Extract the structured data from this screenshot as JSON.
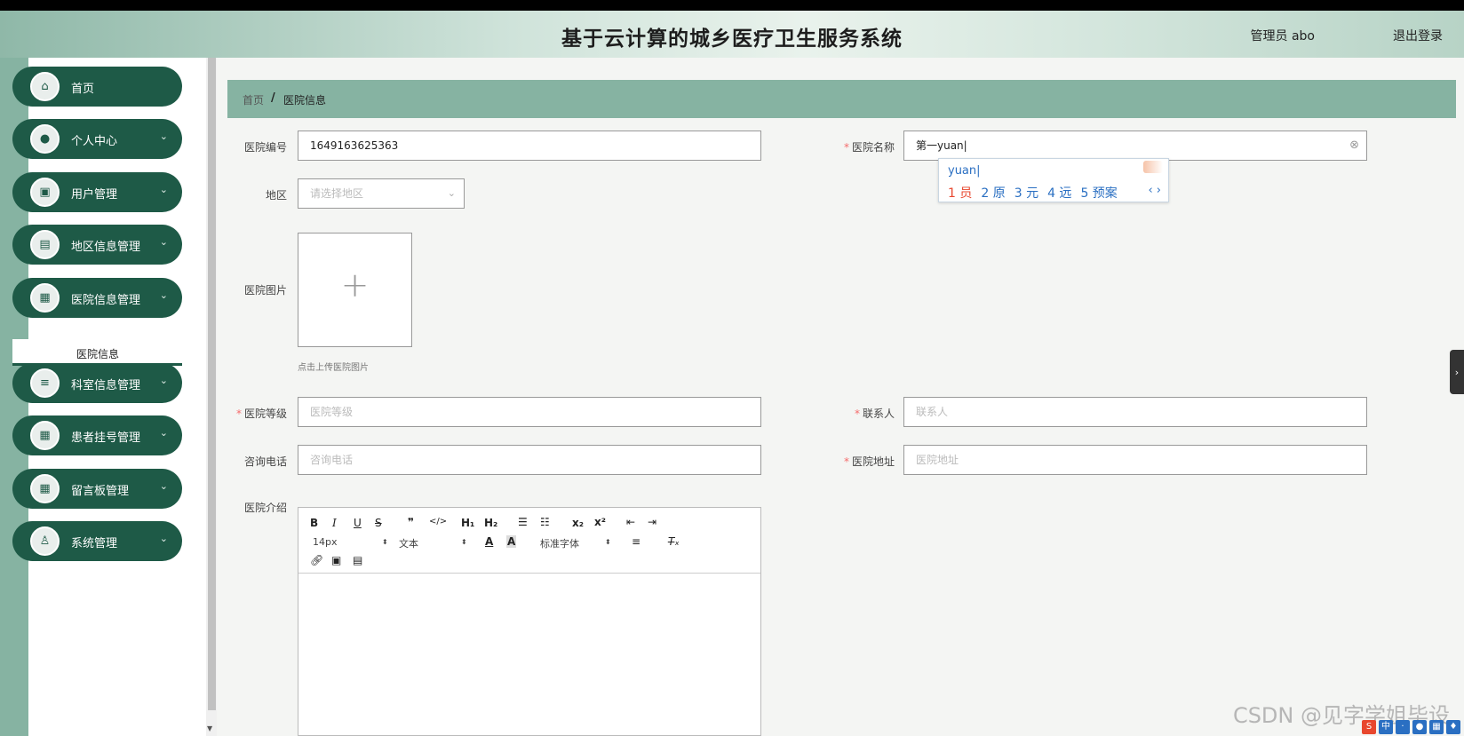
{
  "header": {
    "title": "基于云计算的城乡医疗卫生服务系统",
    "user": "管理员 abo",
    "logout": "退出登录"
  },
  "sidebar": {
    "items": [
      {
        "label": "首页",
        "icon": "home-icon",
        "glyph": "⌂",
        "chevron": ""
      },
      {
        "label": "个人中心",
        "icon": "user-icon",
        "glyph": "●",
        "chevron": "⌄"
      },
      {
        "label": "用户管理",
        "icon": "briefcase-icon",
        "glyph": "▣",
        "chevron": "⌄"
      },
      {
        "label": "地区信息管理",
        "icon": "clipboard-icon",
        "glyph": "▤",
        "chevron": "⌄"
      },
      {
        "label": "医院信息管理",
        "icon": "grid-icon",
        "glyph": "▦",
        "chevron": "⌄"
      },
      {
        "label": "科室信息管理",
        "icon": "list-icon",
        "glyph": "≡",
        "chevron": "⌄"
      },
      {
        "label": "患者挂号管理",
        "icon": "grid-icon",
        "glyph": "▦",
        "chevron": "⌄"
      },
      {
        "label": "留言板管理",
        "icon": "grid-icon",
        "glyph": "▦",
        "chevron": "⌄"
      },
      {
        "label": "系统管理",
        "icon": "person-icon",
        "glyph": "♙",
        "chevron": "⌄"
      }
    ],
    "submenu_active": "医院信息"
  },
  "breadcrumb": {
    "home": "首页",
    "separator": "/",
    "current": "医院信息"
  },
  "form": {
    "hospital_no": {
      "label": "医院编号",
      "value": "1649163625363"
    },
    "hospital_name": {
      "label": "医院名称",
      "value": "第一yuan",
      "required": "*"
    },
    "region": {
      "label": "地区",
      "placeholder": "请选择地区"
    },
    "image": {
      "label": "医院图片",
      "tip": "点击上传医院图片",
      "plus": "+"
    },
    "level": {
      "label": "医院等级",
      "placeholder": "医院等级",
      "required": "*"
    },
    "contact": {
      "label": "联系人",
      "placeholder": "联系人",
      "required": "*"
    },
    "phone": {
      "label": "咨询电话",
      "placeholder": "咨询电话"
    },
    "address": {
      "label": "医院地址",
      "placeholder": "医院地址",
      "required": "*"
    },
    "intro": {
      "label": "医院介绍"
    }
  },
  "ime": {
    "pinyin": "yuan",
    "candidates": [
      "1 员",
      "2 原",
      "3 元",
      "4 远",
      "5 预案"
    ],
    "nav": "‹ ›"
  },
  "editor": {
    "font_size": "14px",
    "text_type": "文本",
    "font_family": "标准字体"
  },
  "watermark": "CSDN @见字学姐毕设",
  "colors": {
    "sidebar_item": "#1e5a47",
    "breadcrumb_bg": "#86b3a2",
    "required": "#f56c6c"
  }
}
